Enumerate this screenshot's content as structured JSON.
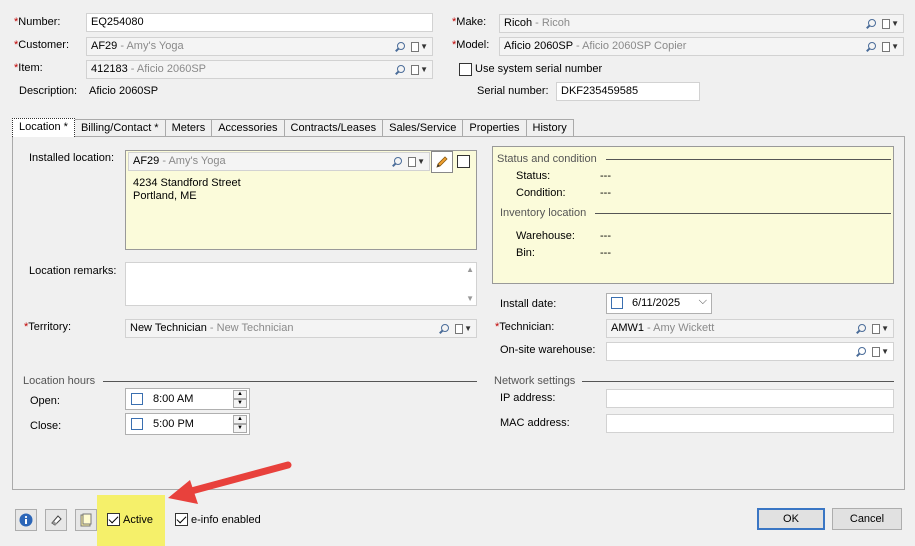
{
  "header": {
    "number": {
      "label": "Number:",
      "value": "EQ254080"
    },
    "customer": {
      "label": "Customer:",
      "code": "AF29",
      "name": " - Amy's Yoga"
    },
    "item": {
      "label": "Item:",
      "code": "412183",
      "name": " - Aficio 2060SP"
    },
    "description": {
      "label": "Description:",
      "value": "Aficio 2060SP"
    },
    "make": {
      "label": "Make:",
      "code": "Ricoh",
      "name": " - Ricoh"
    },
    "model": {
      "label": "Model:",
      "code": "Aficio 2060SP",
      "name": " - Aficio 2060SP Copier"
    },
    "use_system_serial": {
      "label": "Use system serial number",
      "checked": false
    },
    "serial_number": {
      "label": "Serial number:",
      "value": "DKF235459585"
    }
  },
  "tabs": [
    {
      "label": "Location *",
      "active": true
    },
    {
      "label": "Billing/Contact *"
    },
    {
      "label": "Meters"
    },
    {
      "label": "Accessories"
    },
    {
      "label": "Contracts/Leases"
    },
    {
      "label": "Sales/Service"
    },
    {
      "label": "Properties"
    },
    {
      "label": "History"
    }
  ],
  "location": {
    "installed_location": {
      "label": "Installed location:",
      "code": "AF29",
      "name": " - Amy's Yoga",
      "address_line1": "4234 Standford Street",
      "address_line2": "Portland, ME"
    },
    "remarks_label": "Location remarks:",
    "territory": {
      "label": "Territory:",
      "code": "New Technician",
      "name": " - New Technician"
    },
    "status_section": {
      "title": "Status and condition",
      "status_label": "Status:",
      "status_value": "---",
      "condition_label": "Condition:",
      "condition_value": "---"
    },
    "inventory_section": {
      "title": "Inventory location",
      "warehouse_label": "Warehouse:",
      "warehouse_value": "---",
      "bin_label": "Bin:",
      "bin_value": "---"
    },
    "install_date": {
      "label": "Install date:",
      "value": "6/11/2025"
    },
    "technician": {
      "label": "Technician:",
      "code": "AMW1",
      "name": " - Amy Wickett"
    },
    "onsite_warehouse": {
      "label": "On-site warehouse:",
      "value": ""
    },
    "hours": {
      "title": "Location hours",
      "open_label": "Open:",
      "open_value": "8:00 AM",
      "close_label": "Close:",
      "close_value": "5:00 PM"
    },
    "network": {
      "title": "Network settings",
      "ip_label": "IP address:",
      "ip_value": "",
      "mac_label": "MAC address:",
      "mac_value": ""
    }
  },
  "footer": {
    "active": {
      "label": "Active",
      "checked": true
    },
    "einfo": {
      "label": "e-info enabled",
      "checked": true
    },
    "ok_label": "OK",
    "cancel_label": "Cancel"
  },
  "colors": {
    "highlight": "#f5f06a",
    "annotation_arrow": "#e8413c",
    "info_panel": "#fbfbda",
    "default_button_border": "#3a76c4"
  },
  "icons": [
    "search-icon",
    "document-dropdown-icon",
    "pencil-icon",
    "info-icon",
    "eraser-icon",
    "notes-icon",
    "calendar-icon"
  ]
}
